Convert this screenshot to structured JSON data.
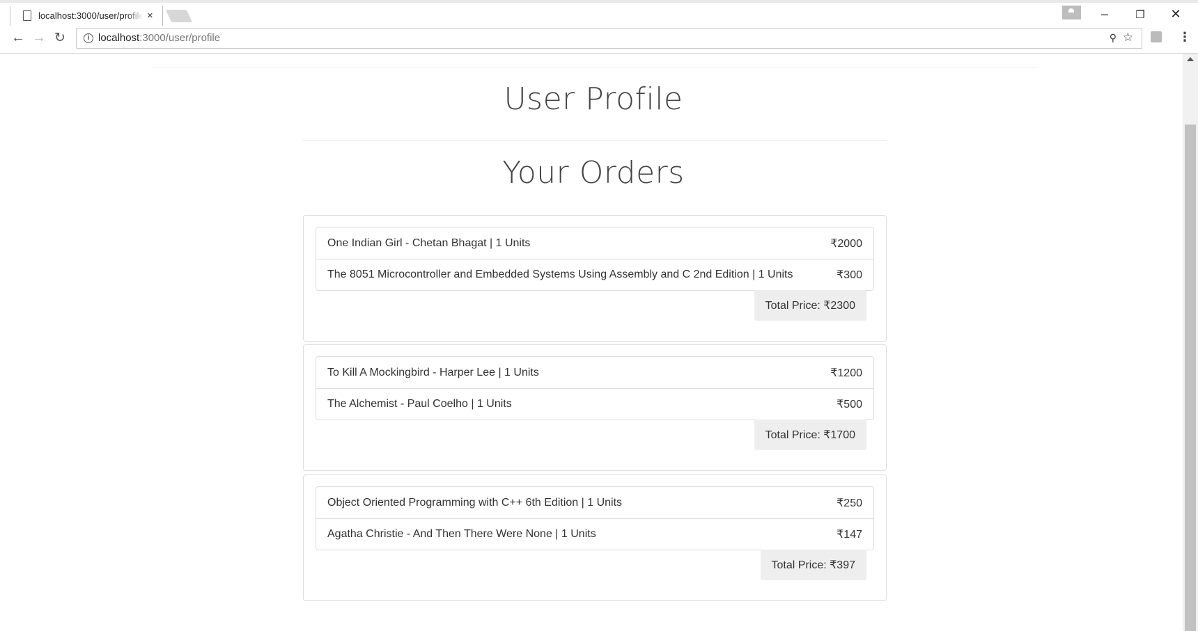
{
  "browser": {
    "tab_title": "localhost:3000/user/profile",
    "tab_close": "×",
    "url_host": "localhost",
    "url_path": ":3000/user/profile"
  },
  "page": {
    "title": "User Profile",
    "orders_heading": "Your Orders"
  },
  "orders": [
    {
      "items": [
        {
          "name": "One Indian Girl - Chetan Bhagat | 1 Units",
          "price": "₹2000"
        },
        {
          "name": "The 8051 Microcontroller and Embedded Systems Using Assembly and C 2nd Edition | 1 Units",
          "price": "₹300"
        }
      ],
      "total": "Total Price: ₹2300"
    },
    {
      "items": [
        {
          "name": "To Kill A Mockingbird - Harper Lee | 1 Units",
          "price": "₹1200"
        },
        {
          "name": "The Alchemist - Paul Coelho | 1 Units",
          "price": "₹500"
        }
      ],
      "total": "Total Price: ₹1700"
    },
    {
      "items": [
        {
          "name": "Object Oriented Programming with C++ 6th Edition | 1 Units",
          "price": "₹250"
        },
        {
          "name": "Agatha Christie - And Then There Were None | 1 Units",
          "price": "₹147"
        }
      ],
      "total": "Total Price: ₹397"
    }
  ]
}
